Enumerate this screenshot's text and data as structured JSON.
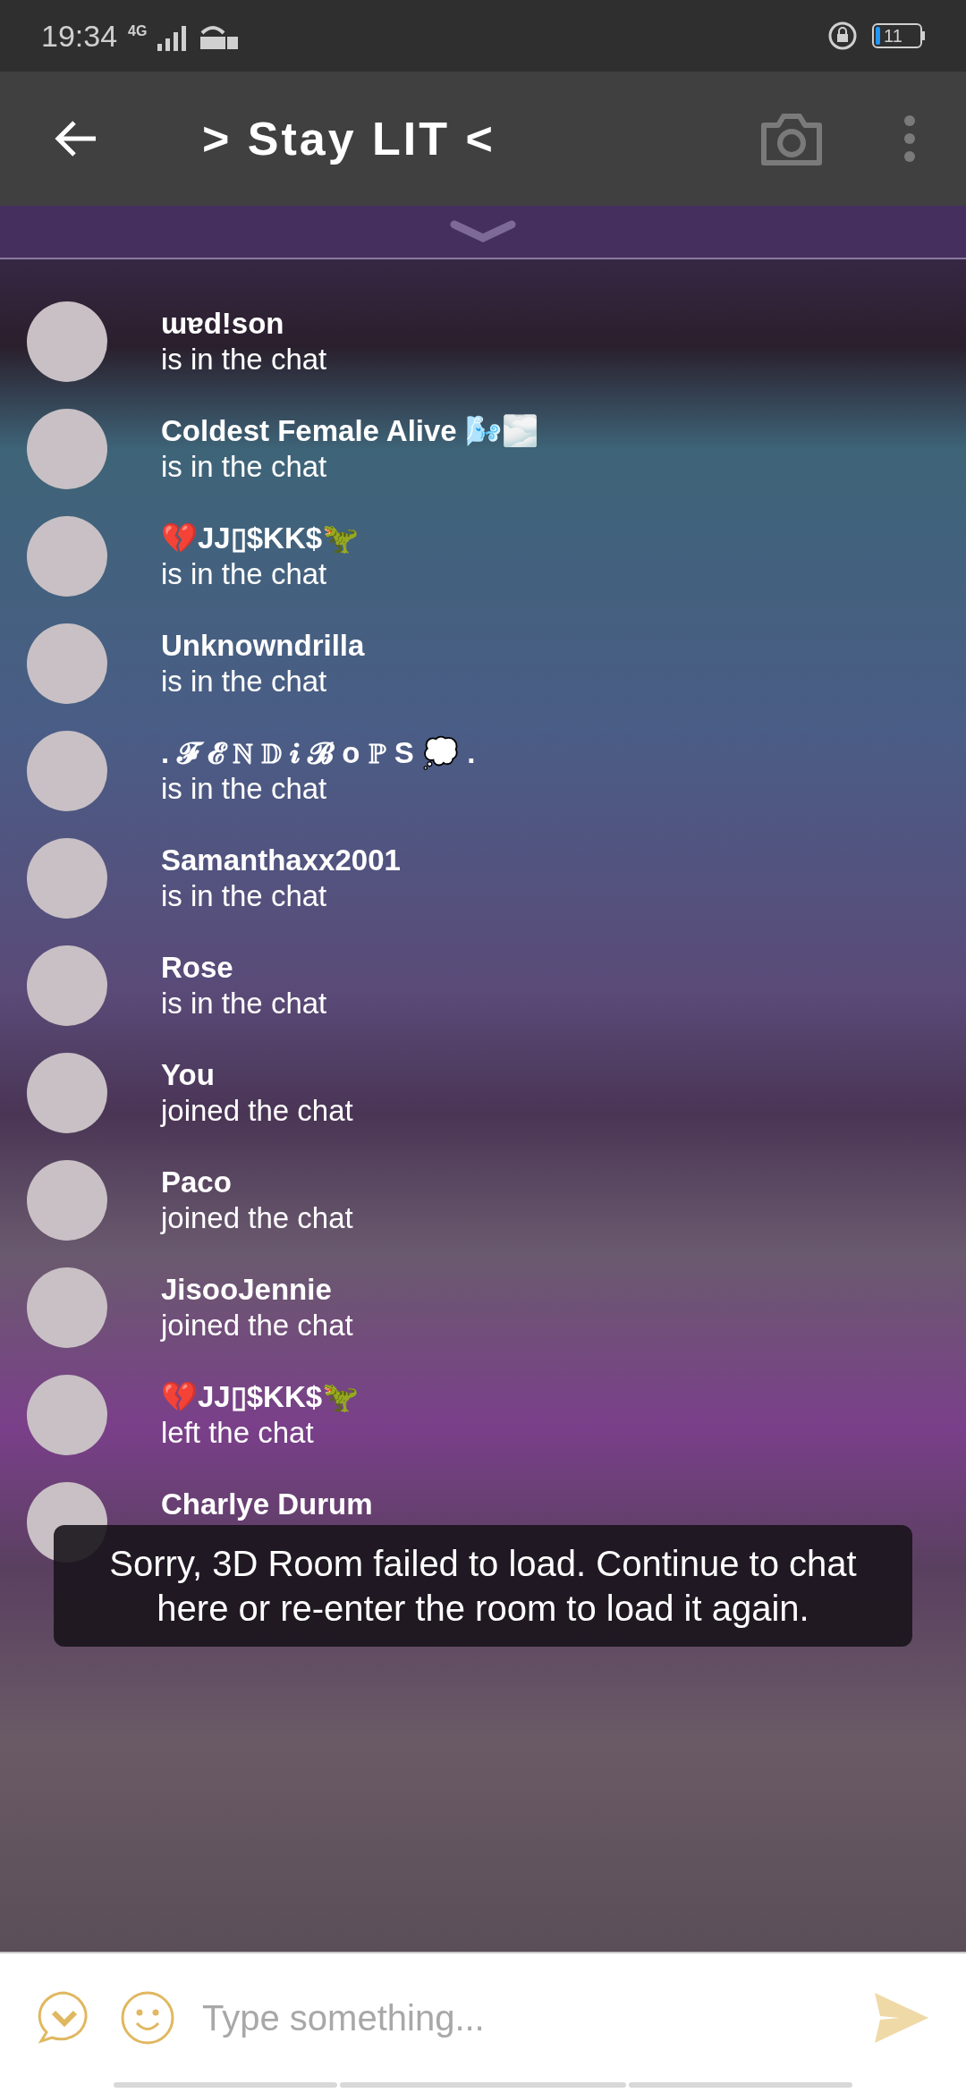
{
  "status_bar": {
    "time": "19:34",
    "network": "4G",
    "battery": "11"
  },
  "header": {
    "title": "> Stay LIT <"
  },
  "members": [
    {
      "name": "ɯɐd!son",
      "status": "is in the chat"
    },
    {
      "name": "Coldest Female Alive 🌬️🌫️",
      "status": "is in the chat"
    },
    {
      "name": "💔JJ▯$KK$🦖",
      "status": "is in the chat"
    },
    {
      "name": "Unknowndrilla",
      "status": "is in the chat"
    },
    {
      "name": ". 𝓕 𝓔 ℕ 𝔻 𝒊 𝓑 ᴏ ℙ S 💭 .",
      "status": "is in the chat"
    },
    {
      "name": "Samanthaxx2001",
      "status": "is in the chat"
    },
    {
      "name": "Rose",
      "status": "is in the chat"
    },
    {
      "name": "You",
      "status": "joined the chat"
    },
    {
      "name": "Paco",
      "status": "joined the chat"
    },
    {
      "name": "JisooJennie",
      "status": "joined the chat"
    },
    {
      "name": "💔JJ▯$KK$🦖",
      "status": "left the chat"
    },
    {
      "name": "Charlye Durum"
    }
  ],
  "toast": {
    "message": "Sorry, 3D Room failed to load. Continue to chat here or re-enter the room to load it again."
  },
  "composer": {
    "placeholder": "Type something..."
  }
}
